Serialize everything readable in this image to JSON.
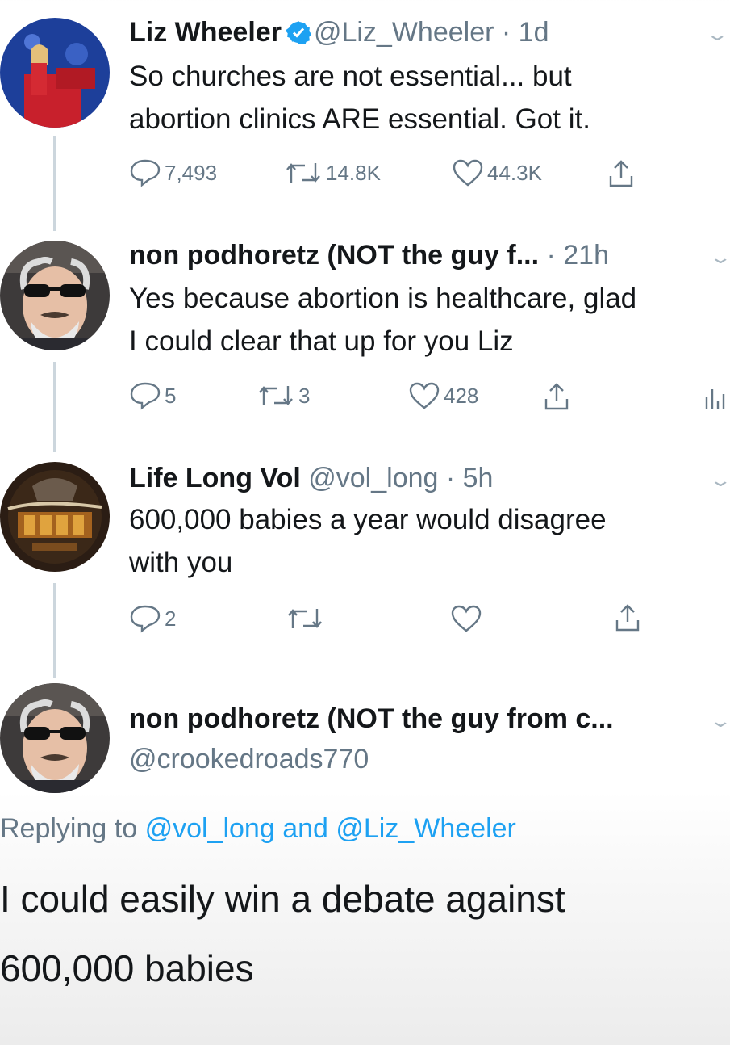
{
  "tweets": [
    {
      "name": "Liz Wheeler",
      "handle": "@Liz_Wheeler",
      "time": "· 1d",
      "verified": true,
      "text_lines": [
        "So churches are not essential... but",
        "abortion clinics ARE essential. Got it."
      ],
      "replies": "7,493",
      "retweets": "14.8K",
      "likes": "44.3K"
    },
    {
      "name": "non podhoretz (NOT the guy f...",
      "time": "· 21h",
      "text_lines": [
        "Yes because abortion is healthcare, glad",
        "I could clear that up for you Liz"
      ],
      "replies": "5",
      "retweets": "3",
      "likes": "428"
    },
    {
      "name": "Life Long Vol",
      "handle": "@vol_long",
      "time": "· 5h",
      "text_lines": [
        "600,000 babies a year would disagree",
        "with you"
      ],
      "replies": "2",
      "retweets": "",
      "likes": ""
    }
  ],
  "main_tweet": {
    "name": "non podhoretz (NOT the guy from c...",
    "handle": "@crookedroads770",
    "replying_prefix": "Replying to",
    "replying_user1": "@vol_long",
    "replying_and": "and",
    "replying_user2": "@Liz_Wheeler",
    "text_lines": [
      "I could easily win a debate against",
      "600,000 babies"
    ]
  },
  "icons": {
    "reply": "reply-icon",
    "retweet": "retweet-icon",
    "like": "heart-icon",
    "share": "share-icon",
    "stats": "analytics-icon",
    "verified": "verified-badge-icon",
    "caret": "chevron-down-icon"
  },
  "colors": {
    "verified_blue": "#1da1f2",
    "link_blue": "#1da1f2",
    "meta_gray": "#657786",
    "icon_gray": "#657786",
    "thread_line": "#ccd6dd",
    "text": "#14171a"
  }
}
